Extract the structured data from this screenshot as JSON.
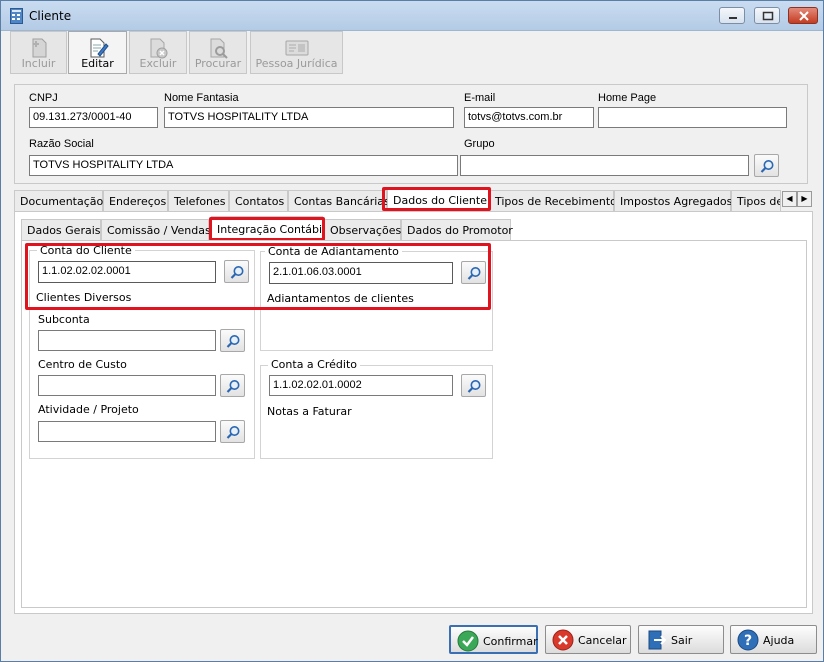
{
  "window": {
    "title": "Cliente"
  },
  "toolbar": {
    "incluir": "Incluir",
    "editar": "Editar",
    "excluir": "Excluir",
    "procurar": "Procurar",
    "pessoa_juridica": "Pessoa Jurídica"
  },
  "header": {
    "cnpj_label": "CNPJ",
    "cnpj_value": "09.131.273/0001-40",
    "nome_fantasia_label": "Nome Fantasia",
    "nome_fantasia_value": "TOTVS HOSPITALITY LTDA",
    "email_label": "E-mail",
    "email_value": "totvs@totvs.com.br",
    "home_page_label": "Home Page",
    "home_page_value": "",
    "razao_social_label": "Razão Social",
    "razao_social_value": "TOTVS HOSPITALITY LTDA",
    "grupo_label": "Grupo",
    "grupo_value": ""
  },
  "main_tabs": [
    "Documentação",
    "Endereços",
    "Telefones",
    "Contatos",
    "Contas Bancárias",
    "Dados do Cliente",
    "Tipos de Recebimento",
    "Impostos Agregados",
    "Tipos de"
  ],
  "sub_tabs": [
    "Dados Gerais",
    "Comissão / Vendas",
    "Integração Contábil",
    "Observações",
    "Dados do Promotor"
  ],
  "integracao": {
    "conta_cliente_title": "Conta do Cliente",
    "conta_cliente_value": "1.1.02.02.02.0001",
    "conta_cliente_desc": "Clientes Diversos",
    "subconta_label": "Subconta",
    "subconta_value": "",
    "centro_custo_label": "Centro de Custo",
    "centro_custo_value": "",
    "atividade_label": "Atividade / Projeto",
    "atividade_value": "",
    "conta_adiantamento_title": "Conta de Adiantamento",
    "conta_adiantamento_value": "2.1.01.06.03.0001",
    "conta_adiantamento_desc": "Adiantamentos de clientes",
    "conta_credito_title": "Conta a Crédito",
    "conta_credito_value": "1.1.02.02.01.0002",
    "conta_credito_desc": "Notas a Faturar"
  },
  "buttons": {
    "confirmar": "Confirmar",
    "cancelar": "Cancelar",
    "sair": "Sair",
    "ajuda": "Ajuda"
  },
  "colors": {
    "highlight": "#e0141e",
    "accent": "#3a6fb4"
  }
}
